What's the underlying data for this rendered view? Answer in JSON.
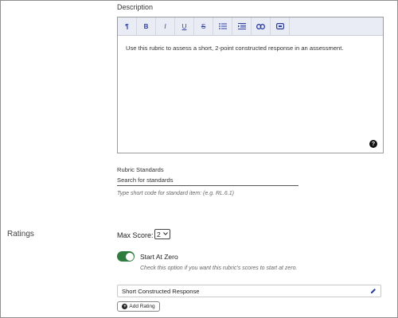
{
  "description": {
    "label": "Description",
    "toolbar": {
      "paragraph": "¶",
      "bold": "B",
      "italic": "I",
      "underline": "U",
      "strikethrough": "S"
    },
    "text": "Use this rubric to assess a short, 2-point constructed response in an assessment.",
    "help_glyph": "?"
  },
  "standards": {
    "label": "Rubric Standards",
    "placeholder": "Search for standards",
    "hint": "Type short code for standard item: (e.g. RL.6.1)"
  },
  "ratings": {
    "section_title": "Ratings",
    "max_score_label": "Max Score:",
    "max_score_value": "2",
    "start_at_zero_label": "Start At Zero",
    "start_at_zero_on": true,
    "start_at_zero_help": "Check this option if you want this rubric's scores to start at zero.",
    "items": [
      {
        "name": "Short Constructed Response"
      }
    ],
    "add_rating_label": "Add Rating",
    "toggle_color": "#2e7d3e",
    "accent_color": "#2a3fa0"
  },
  "icons": {
    "paragraph": "paragraph-icon",
    "bold": "bold-icon",
    "italic": "italic-icon",
    "underline": "underline-icon",
    "strikethrough": "strikethrough-icon",
    "bullet_list": "bullet-list-icon",
    "indent": "indent-icon",
    "link": "link-icon",
    "embed": "embed-icon",
    "help": "help-icon",
    "edit": "pencil-icon",
    "add": "plus-icon"
  }
}
